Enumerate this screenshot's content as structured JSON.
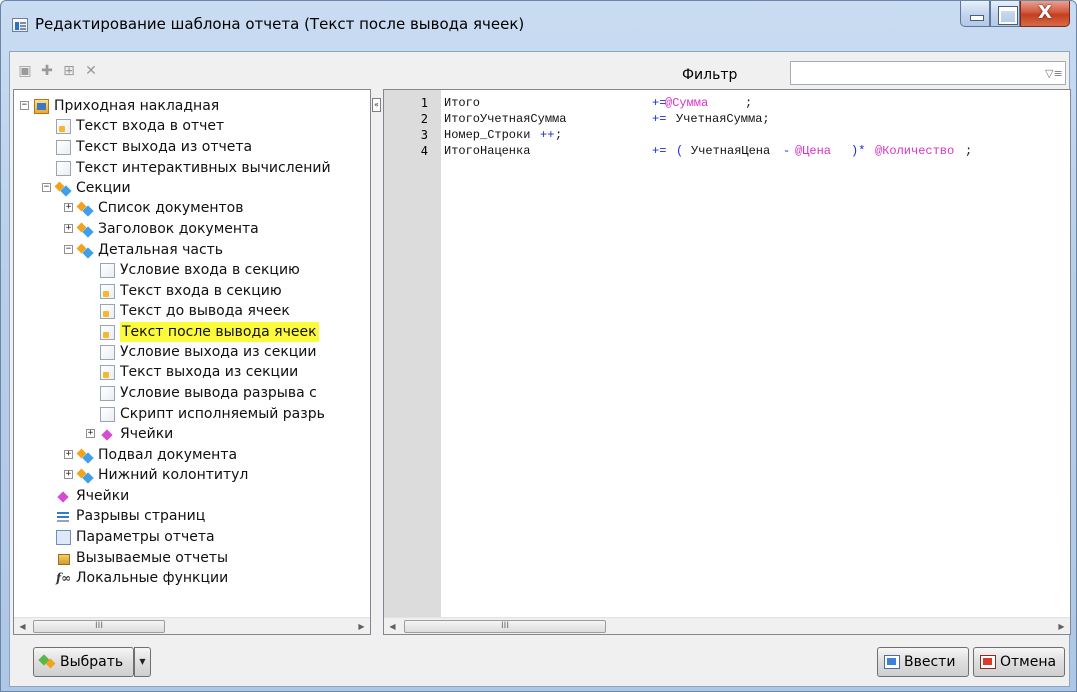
{
  "window": {
    "title": "Редактирование шаблона отчета (Текст после вывода ячеек)",
    "close_glyph": "X"
  },
  "toolbar": {
    "icons": [
      "properties-icon",
      "add-icon",
      "add-child-icon",
      "delete-icon"
    ],
    "filter_label": "Фильтр",
    "filter_value": "",
    "filter_icon_glyph": "▽≡"
  },
  "tree": {
    "items": [
      {
        "label": "Приходная накладная",
        "icon": "report-icon",
        "expander": "−"
      },
      {
        "label": "Текст входа в отчет",
        "icon": "edited-document-icon"
      },
      {
        "label": "Текст выхода из отчета",
        "icon": "document-icon"
      },
      {
        "label": "Текст интерактивных вычислений",
        "icon": "document-icon"
      },
      {
        "label": "Секции",
        "icon": "section-icon",
        "expander": "−"
      },
      {
        "label": "Список документов",
        "icon": "section-icon",
        "expander": "+"
      },
      {
        "label": "Заголовок документа",
        "icon": "section-icon",
        "expander": "+"
      },
      {
        "label": "Детальная часть",
        "icon": "section-icon",
        "expander": "−"
      },
      {
        "label": "Условие входа в секцию",
        "icon": "document-icon"
      },
      {
        "label": "Текст входа в секцию",
        "icon": "edited-document-icon"
      },
      {
        "label": "Текст до вывода ячеек",
        "icon": "edited-document-icon"
      },
      {
        "label": "Текст после вывода ячеек",
        "icon": "edited-document-icon",
        "selected": true
      },
      {
        "label": "Условие выхода из секции",
        "icon": "document-icon"
      },
      {
        "label": "Текст выхода из секции",
        "icon": "edited-document-icon"
      },
      {
        "label": "Условие вывода разрыва с",
        "icon": "document-icon"
      },
      {
        "label": "Скрипт исполняемый разрь",
        "icon": "document-icon"
      },
      {
        "label": "Ячейки",
        "icon": "cells-icon",
        "expander": "+"
      },
      {
        "label": "Подвал документа",
        "icon": "section-icon",
        "expander": "+"
      },
      {
        "label": "Нижний колонтитул",
        "icon": "section-icon",
        "expander": "+"
      },
      {
        "label": "Ячейки",
        "icon": "cells-icon"
      },
      {
        "label": "Разрывы страниц",
        "icon": "page-breaks-icon"
      },
      {
        "label": "Параметры отчета",
        "icon": "parameters-icon"
      },
      {
        "label": "Вызываемые отчеты",
        "icon": "called-reports-icon"
      },
      {
        "label": "Локальные функции",
        "icon": "function-icon",
        "icon_text": "f∞"
      }
    ],
    "scroll_thumb": "III",
    "splitter_glyph": "«"
  },
  "editor": {
    "lines": [
      {
        "num": "1",
        "tokens": [
          {
            "t": "Итого",
            "k": "id"
          },
          {
            "t": "+=",
            "k": "op"
          },
          {
            "t": "@Сумма",
            "k": "var"
          },
          {
            "t": ";",
            "k": "id"
          }
        ]
      },
      {
        "num": "2",
        "tokens": [
          {
            "t": "ИтогоУчетнаяСумма",
            "k": "id"
          },
          {
            "t": "+=",
            "k": "op"
          },
          {
            "t": "УчетнаяСумма;",
            "k": "id"
          }
        ]
      },
      {
        "num": "3",
        "tokens": [
          {
            "t": "Номер_Строки",
            "k": "id"
          },
          {
            "t": "++",
            "k": "op"
          },
          {
            "t": ";",
            "k": "id"
          }
        ]
      },
      {
        "num": "4",
        "tokens": [
          {
            "t": "ИтогоНаценка",
            "k": "id"
          },
          {
            "t": "+=",
            "k": "op"
          },
          {
            "t": "(",
            "k": "op"
          },
          {
            "t": "УчетнаяЦена",
            "k": "id"
          },
          {
            "t": "-",
            "k": "op"
          },
          {
            "t": "@Цена",
            "k": "var"
          },
          {
            "t": ")*",
            "k": "op"
          },
          {
            "t": "@Количество",
            "k": "var"
          },
          {
            "t": ";",
            "k": "id"
          }
        ]
      }
    ],
    "scroll_thumb": "III"
  },
  "footer": {
    "select_label": "Выбрать",
    "ok_label": "Ввести",
    "cancel_label": "Отмена"
  },
  "colors": {
    "keyword_operator": "#1b2bd8",
    "variable": "#d633c8",
    "selection": "#fbfb3c"
  }
}
